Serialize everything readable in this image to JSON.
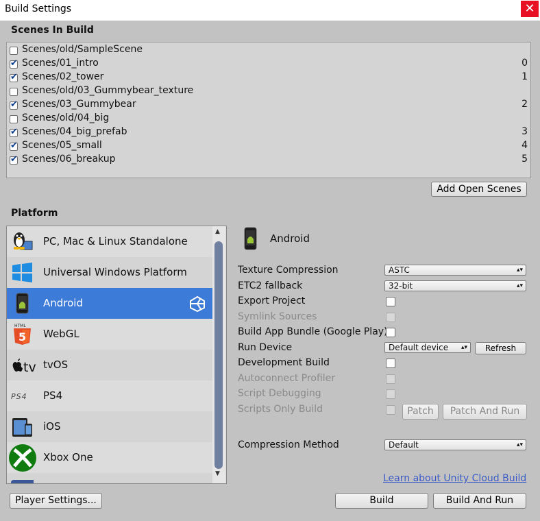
{
  "window": {
    "title": "Build Settings",
    "close_glyph": "✕"
  },
  "scenes": {
    "section_label": "Scenes In Build",
    "items": [
      {
        "name": "Scenes/old/SampleScene",
        "checked": false,
        "index": ""
      },
      {
        "name": "Scenes/01_intro",
        "checked": true,
        "index": "0"
      },
      {
        "name": "Scenes/02_tower",
        "checked": true,
        "index": "1"
      },
      {
        "name": "Scenes/old/03_Gummybear_texture",
        "checked": false,
        "index": ""
      },
      {
        "name": "Scenes/03_Gummybear",
        "checked": true,
        "index": "2"
      },
      {
        "name": "Scenes/old/04_big",
        "checked": false,
        "index": ""
      },
      {
        "name": "Scenes/04_big_prefab",
        "checked": true,
        "index": "3"
      },
      {
        "name": "Scenes/05_small",
        "checked": true,
        "index": "4"
      },
      {
        "name": "Scenes/06_breakup",
        "checked": true,
        "index": "5"
      }
    ],
    "add_open_scenes_label": "Add Open Scenes"
  },
  "platform": {
    "section_label": "Platform",
    "items": [
      {
        "label": "PC, Mac & Linux Standalone",
        "icon": "standalone-icon"
      },
      {
        "label": "Universal Windows Platform",
        "icon": "windows-icon"
      },
      {
        "label": "Android",
        "icon": "android-icon",
        "selected": true
      },
      {
        "label": "WebGL",
        "icon": "html5-icon"
      },
      {
        "label": "tvOS",
        "icon": "apple-tv-icon"
      },
      {
        "label": "PS4",
        "icon": "ps4-icon"
      },
      {
        "label": "iOS",
        "icon": "ios-icon"
      },
      {
        "label": "Xbox One",
        "icon": "xbox-icon"
      }
    ]
  },
  "settings": {
    "platform_title": "Android",
    "texture_compression": {
      "label": "Texture Compression",
      "value": "ASTC"
    },
    "etc2_fallback": {
      "label": "ETC2 fallback",
      "value": "32-bit"
    },
    "export_project": {
      "label": "Export Project",
      "checked": false
    },
    "symlink_sources": {
      "label": "Symlink Sources",
      "checked": false
    },
    "build_app_bundle": {
      "label": "Build App Bundle (Google Play)",
      "checked": false
    },
    "run_device": {
      "label": "Run Device",
      "value": "Default device",
      "refresh_label": "Refresh"
    },
    "development_build": {
      "label": "Development Build",
      "checked": false
    },
    "autoconnect_profiler": {
      "label": "Autoconnect Profiler",
      "checked": false
    },
    "script_debugging": {
      "label": "Script Debugging",
      "checked": false
    },
    "scripts_only_build": {
      "label": "Scripts Only Build",
      "checked": false,
      "patch_label": "Patch",
      "patch_and_run_label": "Patch And Run"
    },
    "compression_method": {
      "label": "Compression Method",
      "value": "Default"
    }
  },
  "footer": {
    "cloud_build_link": "Learn about Unity Cloud Build",
    "player_settings_label": "Player Settings...",
    "build_label": "Build",
    "build_and_run_label": "Build And Run"
  },
  "colors": {
    "selection": "#3d7bd9",
    "link": "#3b5bc7",
    "close": "#e81123"
  }
}
